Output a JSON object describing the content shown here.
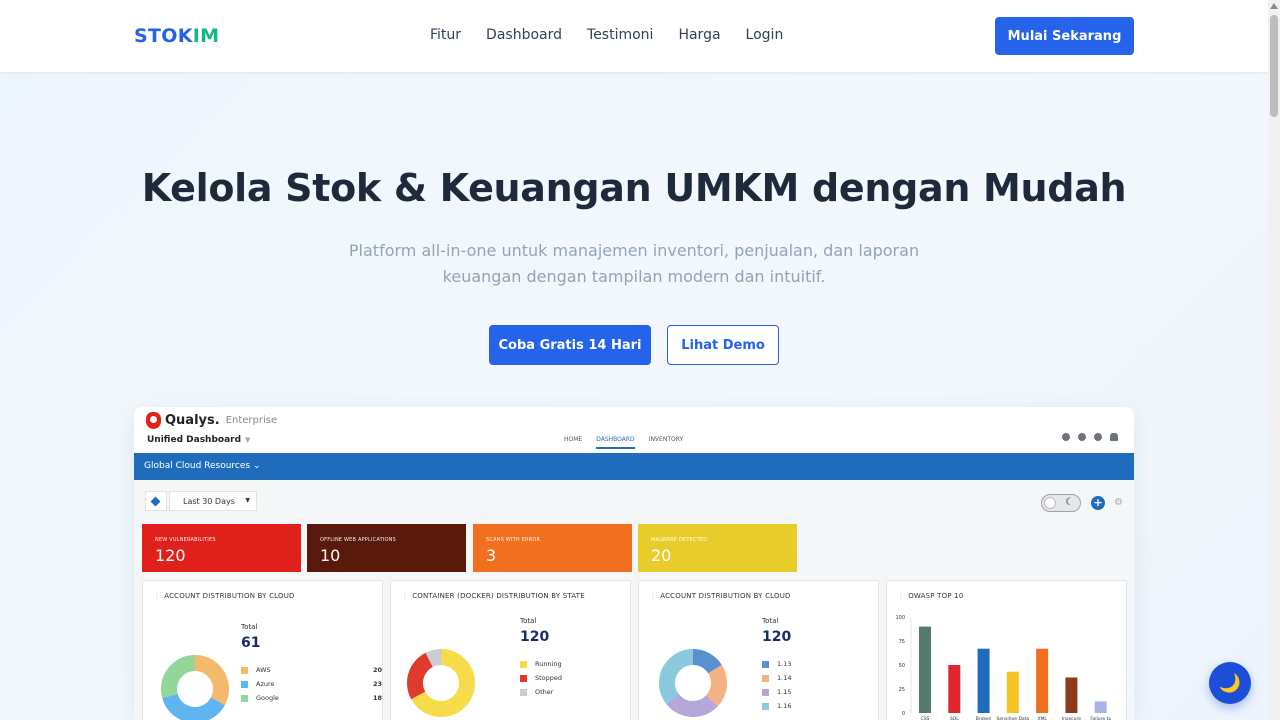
{
  "header": {
    "logo_part1": "STOK",
    "logo_part2": "IM",
    "nav": [
      "Fitur",
      "Dashboard",
      "Testimoni",
      "Harga",
      "Login"
    ],
    "cta": "Mulai Sekarang"
  },
  "hero": {
    "title": "Kelola Stok & Keuangan UMKM dengan Mudah",
    "subtitle": "Platform all-in-one untuk manajemen inventori, penjualan, dan laporan keuangan dengan tampilan modern dan intuitif.",
    "primary_button": "Coba Gratis 14 Hari",
    "secondary_button": "Lihat Demo"
  },
  "dashboard": {
    "brand": "Qualys.",
    "brand_suffix": "Enterprise",
    "view": "Unified Dashboard",
    "tabs": [
      "HOME",
      "DASHBOARD",
      "INVENTORY"
    ],
    "active_tab": "DASHBOARD",
    "resource_bar": "Global Cloud Resources",
    "date_range": "Last 30 Days",
    "stats": [
      {
        "label": "New Vulnerabilities",
        "value": "120",
        "color": "#e0201a"
      },
      {
        "label": "Offline Web Applications",
        "value": "10",
        "color": "#5a1a0b"
      },
      {
        "label": "Scans with Error",
        "value": "3",
        "color": "#f07020"
      },
      {
        "label": "Malware Detected",
        "value": "20",
        "color": "#e8cc2a"
      }
    ],
    "panels": [
      {
        "title": "Account Distribution by Cloud",
        "total_label": "Total",
        "total": "61",
        "legend": [
          {
            "name": "AWS",
            "count": 20,
            "color": "#f5b96b"
          },
          {
            "name": "Azure",
            "count": 23,
            "color": "#5fb5ef"
          },
          {
            "name": "Google",
            "count": 18,
            "color": "#94d59a"
          }
        ]
      },
      {
        "title": "Container (Docker) Distribution by State",
        "total_label": "Total",
        "total": "120",
        "legend": [
          {
            "name": "Running",
            "count": 87,
            "color": "#f6dc4a"
          },
          {
            "name": "Stopped",
            "count": 33,
            "color": "#e03a2c"
          },
          {
            "name": "Other",
            "count": 10,
            "color": "#c8cdd3"
          }
        ]
      },
      {
        "title": "Account Distribution by Cloud",
        "total_label": "Total",
        "total": "120",
        "legend": [
          {
            "name": "1.13",
            "count": 13,
            "color": "#5a8fd0"
          },
          {
            "name": "1.14",
            "count": 17,
            "color": "#f3b184"
          },
          {
            "name": "1.15",
            "count": 22,
            "color": "#b5a6dc"
          },
          {
            "name": "1.16",
            "count": 29,
            "color": "#8cc8de"
          }
        ]
      },
      {
        "title": "OWASP Top 10"
      }
    ]
  },
  "chart_data": {
    "type": "bar",
    "title": "OWASP Top 10",
    "categories": [
      "CSS",
      "SQL",
      "Broken",
      "Sensitive Data",
      "XML",
      "Insecure",
      "Failure to"
    ],
    "values": [
      90,
      50,
      67,
      43,
      67,
      37,
      12
    ],
    "colors": [
      "#55796b",
      "#e1252d",
      "#1f6cbd",
      "#f7c324",
      "#f07020",
      "#8b3c1b",
      "#a6b4e8"
    ],
    "ylim": [
      0,
      100
    ],
    "yticks": [
      0,
      25,
      50,
      75,
      100
    ]
  }
}
